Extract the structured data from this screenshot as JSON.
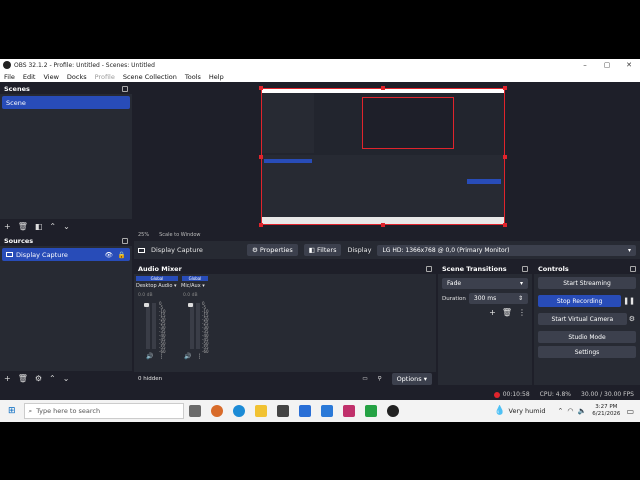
{
  "window": {
    "title": "OBS 32.1.2 - Profile: Untitled - Scenes: Untitled",
    "minimize": "–",
    "maximize": "▢",
    "close": "✕"
  },
  "menu": [
    "File",
    "Edit",
    "View",
    "Docks",
    "Profile",
    "Scene Collection",
    "Tools",
    "Help"
  ],
  "preview": {
    "zoom": "25%",
    "scale_mode": "Scale to Window"
  },
  "scenes": {
    "title": "Scenes",
    "items": [
      "Scene"
    ]
  },
  "sources": {
    "title": "Sources",
    "items": [
      "Display Capture"
    ]
  },
  "context_bar": {
    "source": "Display Capture",
    "properties": "Properties",
    "filters": "Filters",
    "display_label": "Display",
    "display_value": "LG HD: 1366x768 @ 0,0 (Primary Monitor)"
  },
  "audio_mixer": {
    "title": "Audio Mixer",
    "channels": [
      {
        "name": "Desktop Audio",
        "badge": "Global",
        "db": "0.0 dB"
      },
      {
        "name": "Mic/Aux",
        "badge": "Global",
        "db": "0.0 dB"
      }
    ],
    "ticks": [
      "0",
      "-5",
      "-10",
      "-15",
      "-20",
      "-25",
      "-30",
      "-35",
      "-40",
      "-45",
      "-50",
      "-55",
      "-60"
    ],
    "hidden": "0 hidden",
    "options": "Options"
  },
  "scene_transitions": {
    "title": "Scene Transitions",
    "transition": "Fade",
    "duration_label": "Duration",
    "duration_value": "300 ms"
  },
  "controls": {
    "title": "Controls",
    "start_streaming": "Start Streaming",
    "stop_recording": "Stop Recording",
    "start_virtual_camera": "Start Virtual Camera",
    "studio_mode": "Studio Mode",
    "settings": "Settings"
  },
  "status": {
    "rec_time": "00:10:58",
    "cpu": "CPU: 4.8%",
    "fps": "30.00 / 30.00 FPS"
  },
  "taskbar": {
    "search_placeholder": "Type here to search",
    "weather": "Very humid",
    "time": "3:27 PM",
    "date": "6/21/2026"
  },
  "colors": {
    "accent": "#284cb8",
    "selection_red": "#e0242c",
    "dock_bg": "#272a33",
    "app_bg": "#1e1f29"
  }
}
